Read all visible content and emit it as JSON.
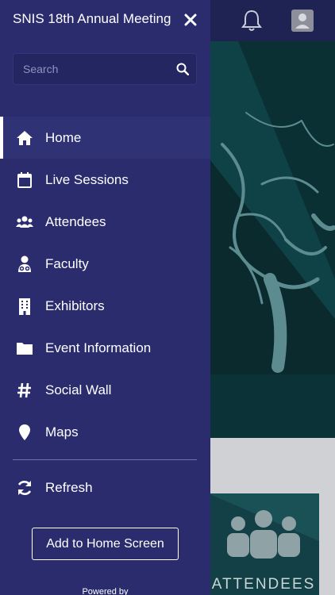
{
  "drawer": {
    "title": "SNIS 18th Annual Meeting",
    "close_icon": "close-icon",
    "search": {
      "placeholder": "Search",
      "value": "",
      "icon": "search-icon"
    },
    "menu": [
      {
        "label": "Home",
        "icon": "home-icon",
        "active": true
      },
      {
        "label": "Live Sessions",
        "icon": "calendar-icon",
        "active": false
      },
      {
        "label": "Attendees",
        "icon": "users-icon",
        "active": false
      },
      {
        "label": "Faculty",
        "icon": "faculty-icon",
        "active": false
      },
      {
        "label": "Exhibitors",
        "icon": "building-icon",
        "active": false
      },
      {
        "label": "Event Information",
        "icon": "folder-icon",
        "active": false
      },
      {
        "label": "Social Wall",
        "icon": "hashtag-icon",
        "active": false
      },
      {
        "label": "Maps",
        "icon": "map-pin-icon",
        "active": false
      }
    ],
    "refresh_label": "Refresh",
    "add_home_label": "Add to Home Screen",
    "powered_by": "Powered by"
  },
  "background": {
    "tile_label": "ATTENDEES",
    "bell_icon": "bell-icon",
    "avatar_icon": "avatar-icon"
  },
  "colors": {
    "drawer_bg": "#2a2c6e",
    "active_item_bg": "#2f3275",
    "topbar_bg": "#1f2353",
    "hero_bg": "#0e3f44"
  }
}
